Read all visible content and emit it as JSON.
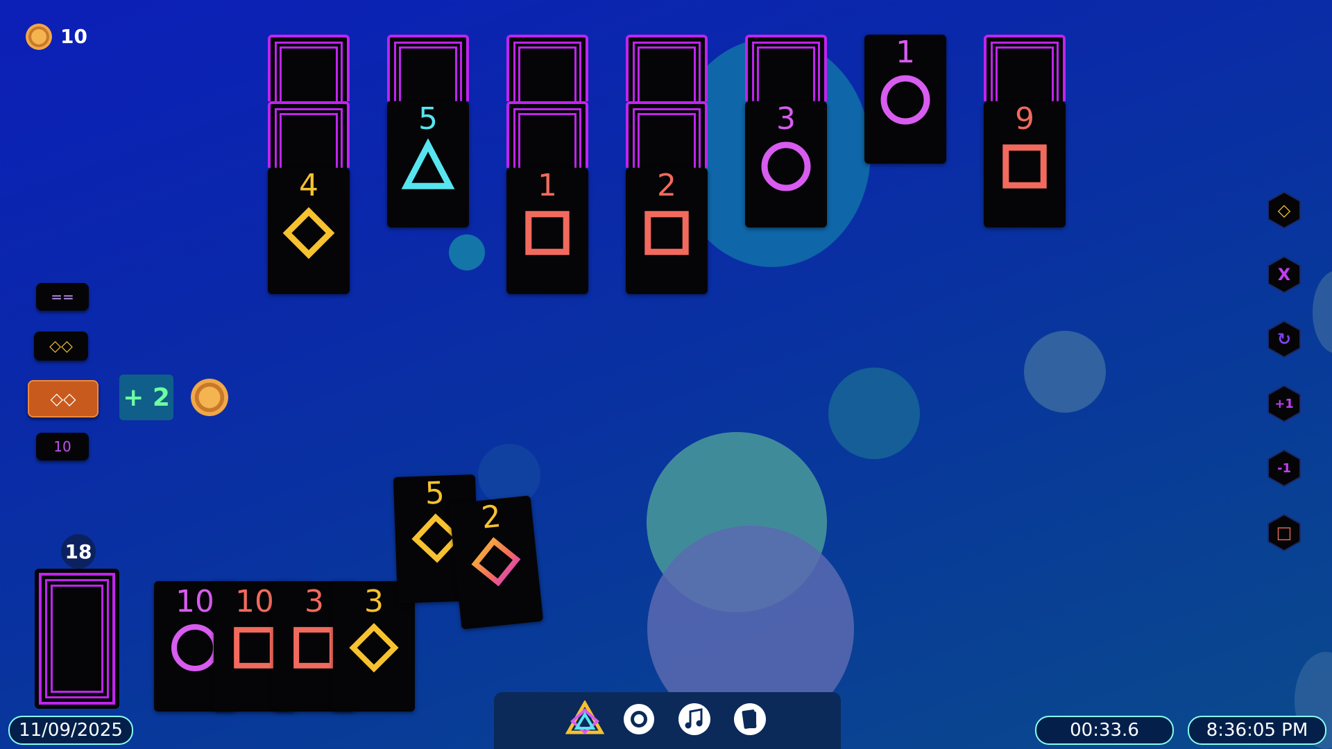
{
  "hud": {
    "coins": "10"
  },
  "colors": {
    "purple": "#c024f0",
    "yellow": "#f7c230",
    "coral": "#f26a5e",
    "cyan": "#57e6f0",
    "violet": "#d85cf0"
  },
  "tableau": [
    {
      "top_value": "4",
      "symbol": "diamond",
      "color": "#f7c230"
    },
    {
      "top_value": "5",
      "symbol": "triangle",
      "color": "#57e6f0"
    },
    {
      "top_value": "1",
      "symbol": "square",
      "color": "#f26a5e"
    },
    {
      "top_value": "2",
      "symbol": "square",
      "color": "#f26a5e"
    },
    {
      "top_value": "3",
      "symbol": "circle",
      "color": "#d85cf0"
    },
    {
      "top_value": "1",
      "symbol": "circle",
      "color": "#d85cf0"
    },
    {
      "top_value": "9",
      "symbol": "square",
      "color": "#f26a5e"
    }
  ],
  "left_panel": {
    "equals_label": "==",
    "pair_label": "◇◇",
    "active_pair_label": "◇◇",
    "bonus_label": "+ 2",
    "count_label": "10"
  },
  "stock": {
    "count": "18"
  },
  "hand": [
    {
      "value": "10",
      "symbol": "circle",
      "color": "#d85cf0"
    },
    {
      "value": "10",
      "symbol": "square",
      "color": "#f26a5e"
    },
    {
      "value": "3",
      "symbol": "square",
      "color": "#f26a5e"
    },
    {
      "value": "3",
      "symbol": "diamond",
      "color": "#f7c230"
    }
  ],
  "played": [
    {
      "value": "5",
      "symbol": "diamond",
      "color": "#f7c230"
    },
    {
      "value": "2",
      "symbol": "diamond-rainbow",
      "color": "#f7c230"
    }
  ],
  "right_tools": [
    {
      "label": "◇",
      "name": "diamond-filter-button",
      "icon": "diamond-icon"
    },
    {
      "label": "X",
      "name": "clear-button",
      "icon": "x-icon"
    },
    {
      "label": "↻",
      "name": "restart-button",
      "icon": "refresh-icon"
    },
    {
      "label": "+1",
      "name": "plus-one-button",
      "icon": "plus-one-icon"
    },
    {
      "label": "-1",
      "name": "minus-one-button",
      "icon": "minus-one-icon"
    },
    {
      "label": "□",
      "name": "square-filter-button",
      "icon": "square-icon"
    }
  ],
  "toolbar": {
    "items": [
      "shapes-logo-icon",
      "settings-icon",
      "music-icon",
      "cards-icon"
    ]
  },
  "footer": {
    "date": "11/09/2025",
    "timer": "00:33.6",
    "clock": "8:36:05 PM"
  }
}
